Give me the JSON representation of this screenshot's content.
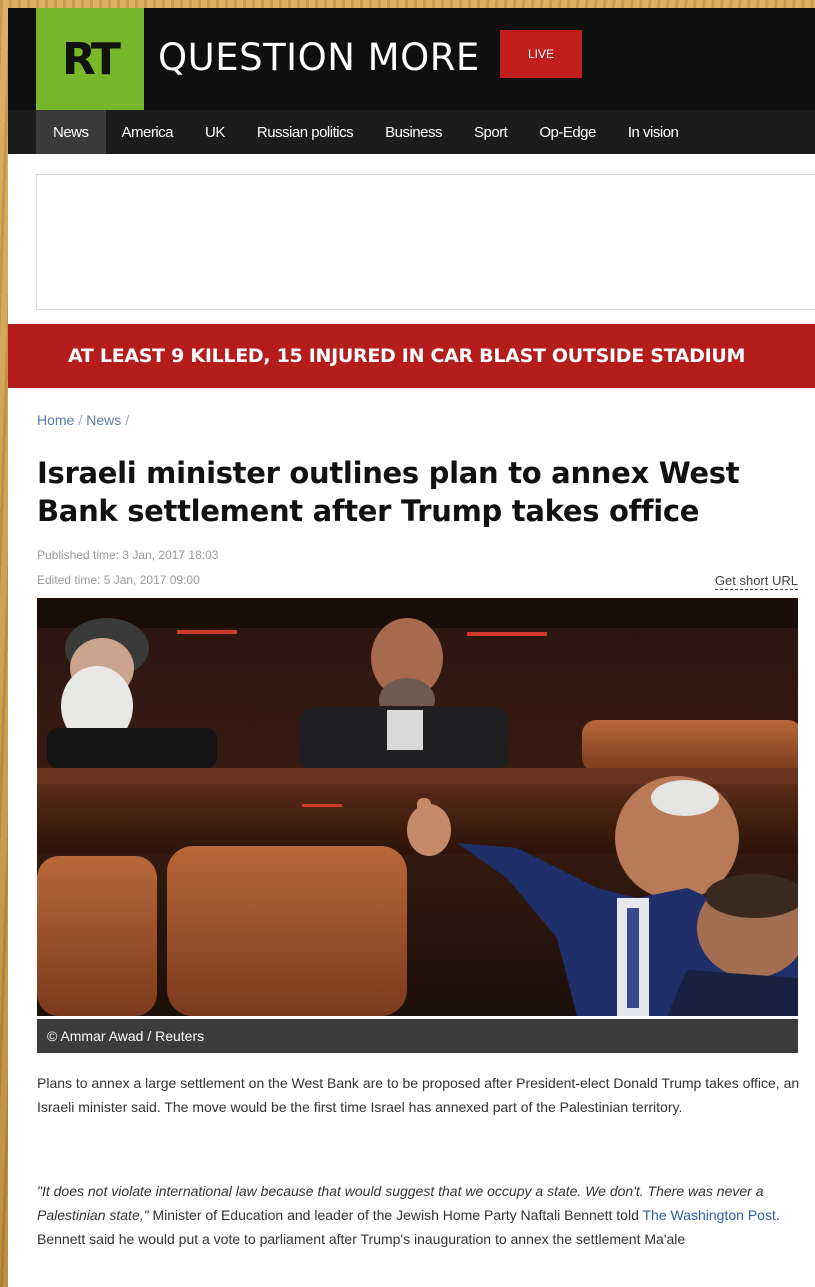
{
  "header": {
    "logo": "RT",
    "tagline": "QUESTION MORE",
    "live_label": "LIVE"
  },
  "nav": {
    "items": [
      "News",
      "America",
      "UK",
      "Russian politics",
      "Business",
      "Sport",
      "Op-Edge",
      "In vision"
    ],
    "active": "News"
  },
  "breaking": {
    "text": "AT LEAST 9 KILLED, 15 INJURED IN CAR BLAST OUTSIDE STADIUM"
  },
  "breadcrumb": {
    "home": "Home",
    "section": "News",
    "separator": "/"
  },
  "article": {
    "title": "Israeli minister outlines plan to annex West Bank settlement after Trump takes office",
    "published": "Published time: 3 Jan, 2017 18:03",
    "edited": "Edited time: 5 Jan, 2017 09:00",
    "short_url_label": "Get short URL",
    "photo_caption": "© Ammar Awad / Reuters",
    "paragraph1": "Plans to annex a large settlement on the West Bank are to be proposed after President-elect Donald Trump takes office, an Israeli minister said. The move would be the first time Israel has annexed part of the Palestinian territory.",
    "paragraph2_quote": "\"It does not violate international law because that would suggest that we occupy a state. We don't. There was never a Palestinian state,\"",
    "paragraph2_mid": " Minister of Education and leader of the Jewish Home Party Naftali Bennett told ",
    "paragraph2_link": "The Washington Post",
    "paragraph2_end": ". Bennett said he would put a vote to parliament after Trump's inauguration to annex the settlement Ma'ale"
  },
  "colors": {
    "logo_green": "#77b82a",
    "live_red": "#c11e1e",
    "breaking_red": "#b51d1d",
    "link_blue": "#2e62a4"
  }
}
